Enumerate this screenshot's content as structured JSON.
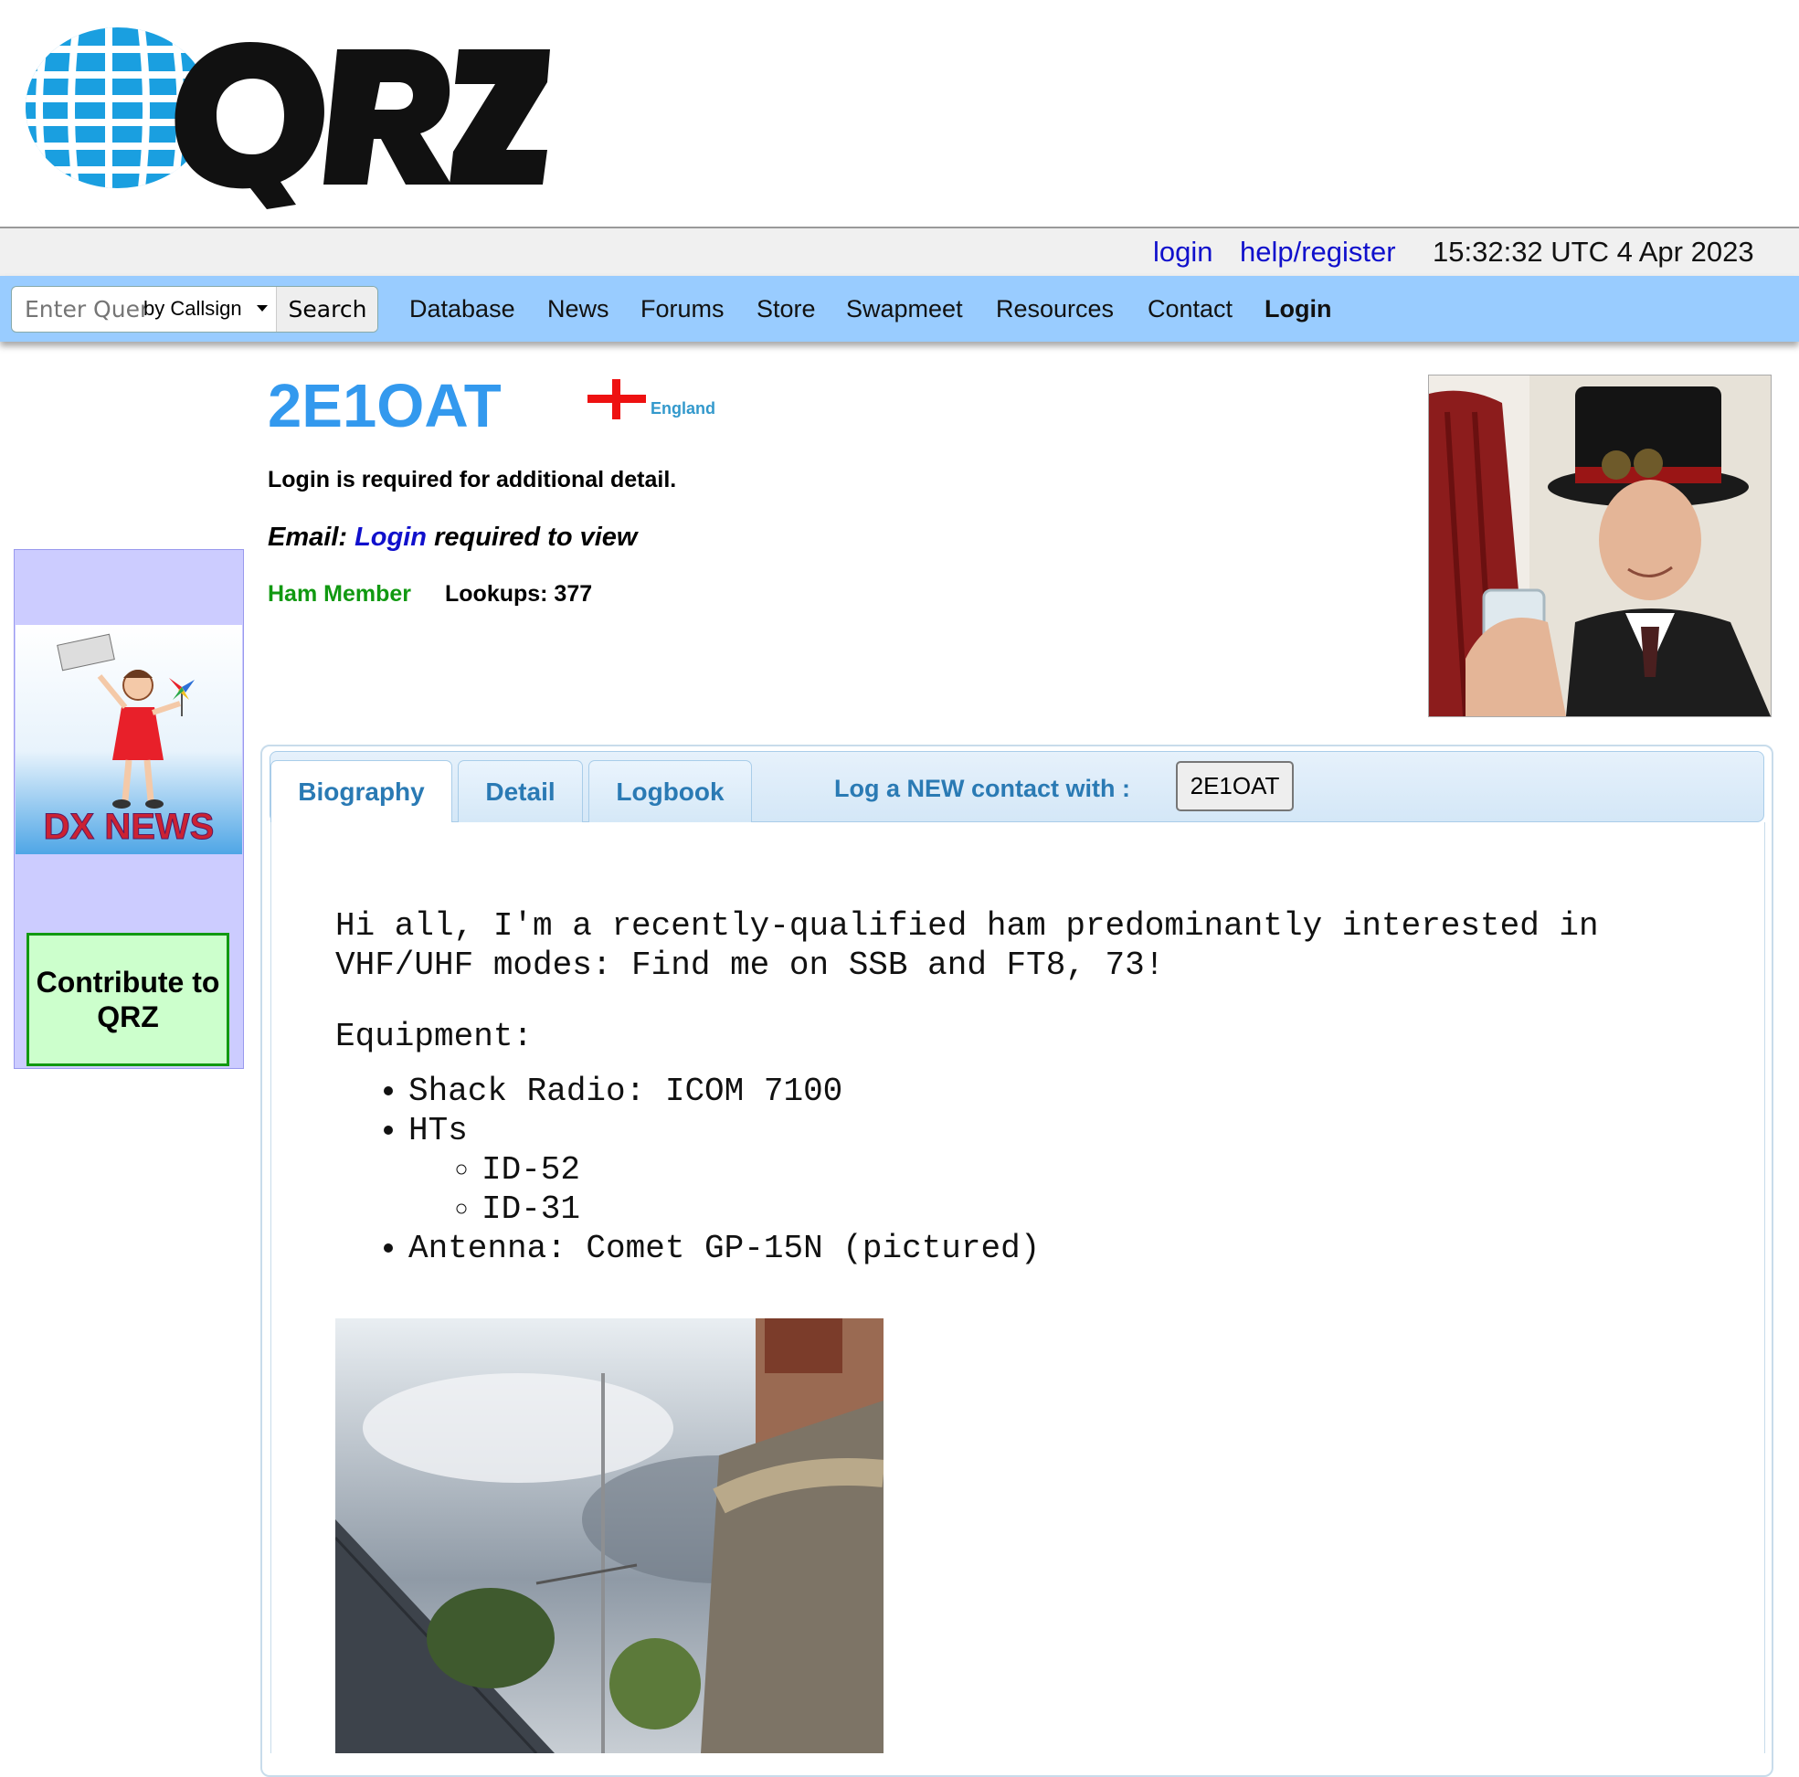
{
  "colors": {
    "nav_bg": "#99ccff",
    "callsign": "#3399ee",
    "link": "#1010cc",
    "ham_member": "#119911",
    "tab_text": "#2a7ab4",
    "sidebar_bg": "#ccccff",
    "contribute_bg": "#ccffcc"
  },
  "logo": {
    "text": "QRZ"
  },
  "topbar": {
    "login": "login",
    "help_register": "help/register",
    "clock": "15:32:32 UTC 4 Apr 2023"
  },
  "search": {
    "placeholder": "Enter Query",
    "select_value": "by Callsign",
    "button": "Search"
  },
  "nav": {
    "items": [
      "Database",
      "News",
      "Forums",
      "Store",
      "Swapmeet",
      "Resources",
      "Contact",
      "Login"
    ]
  },
  "sidebar": {
    "ad_text": "DX NEWS",
    "contribute": "Contribute to QRZ"
  },
  "profile": {
    "callsign": "2E1OAT",
    "country": "England",
    "login_required": "Login is required for additional detail.",
    "email_label": "Email:",
    "email_login": "Login",
    "email_suffix": "required to view",
    "member_type": "Ham Member",
    "lookups": "Lookups: 377"
  },
  "tabs": {
    "items": [
      "Biography",
      "Detail",
      "Logbook"
    ],
    "log_label": "Log a NEW contact with :",
    "log_value": "2E1OAT"
  },
  "bio": {
    "intro": "Hi all, I'm a recently-qualified ham predominantly interested in VHF/UHF modes: Find me on SSB and FT8, 73!",
    "equipment_heading": "Equipment:",
    "items": [
      {
        "text": "Shack Radio: ICOM 7100"
      },
      {
        "text": "HTs",
        "subitems": [
          "ID-52",
          "ID-31"
        ]
      },
      {
        "text": "Antenna: Comet GP-15N (pictured)"
      }
    ]
  },
  "icons": {
    "logo": "qrz-globe-logo",
    "flag": "england-flag-icon",
    "caret": "chevron-down-icon"
  }
}
